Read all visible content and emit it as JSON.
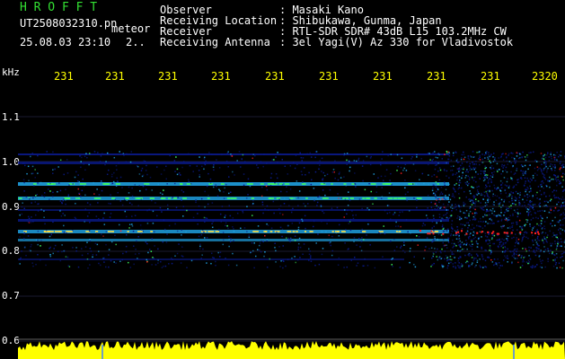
{
  "header": {
    "brand": "H R O F F T",
    "filename": "UT2508032310.pn",
    "tag": "meteor",
    "datetime": "25.08.03 23:10",
    "counter": "2..",
    "info": [
      {
        "label": "Observer",
        "value": ": Masaki Kano"
      },
      {
        "label": "Receiving Location",
        "value": ": Shibukawa, Gunma, Japan"
      },
      {
        "label": "Receiver",
        "value": ": RTL-SDR SDR# 43dB L15 103.2MHz CW"
      },
      {
        "label": "Receiving Antenna",
        "value": ": 3el Yagi(V) Az 330 for Vladivostok"
      }
    ]
  },
  "axis": {
    "unit": "kHz",
    "y_labels": [
      "1.1",
      "1.0",
      "0.9",
      "0.8",
      "0.7",
      "0.6"
    ],
    "x_labels": [
      "231",
      "231",
      "231",
      "231",
      "231",
      "231",
      "231",
      "231",
      "231",
      "2320"
    ]
  },
  "colors": {
    "background": "#000000",
    "header_green": "#33e033",
    "header_white": "#ffffff",
    "tick_yellow": "#ffff00",
    "noise_yellow": "#ffff00",
    "waterfall_low": "#0a1a8c",
    "waterfall_mid": "#1fa0e0",
    "waterfall_high": "#ff2020"
  }
}
